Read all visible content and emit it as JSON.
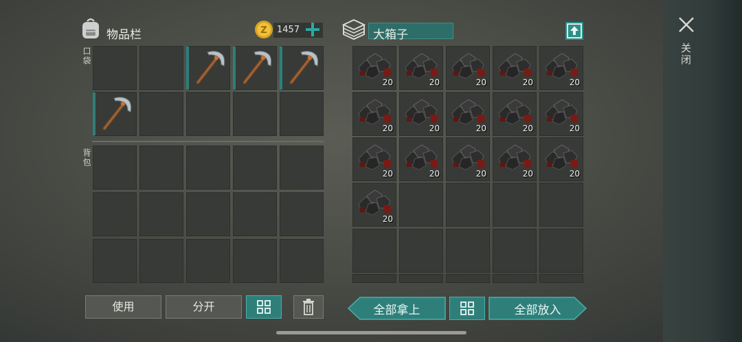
{
  "inventory": {
    "title": "物品栏",
    "pocket_label": "口袋",
    "backpack_label": "背包",
    "currency": "1457",
    "pocket_slots": [
      {
        "item": "",
        "count": ""
      },
      {
        "item": "",
        "count": ""
      },
      {
        "item": "pickaxe",
        "count": ""
      },
      {
        "item": "pickaxe",
        "count": ""
      },
      {
        "item": "pickaxe",
        "count": ""
      },
      {
        "item": "pickaxe",
        "count": ""
      },
      {
        "item": "",
        "count": ""
      },
      {
        "item": "",
        "count": ""
      },
      {
        "item": "",
        "count": ""
      },
      {
        "item": "",
        "count": ""
      }
    ],
    "backpack_slots": 15,
    "use_button": "使用",
    "split_button": "分开"
  },
  "chest": {
    "title": "大箱子",
    "item_count_label": "20",
    "filled_slots": 16,
    "take_all_button": "全部拿上",
    "put_all_button": "全部放入"
  },
  "close": {
    "label": "关闭"
  },
  "colors": {
    "accent_teal": "#2e7f7a",
    "slot_bg": "#383a37"
  }
}
